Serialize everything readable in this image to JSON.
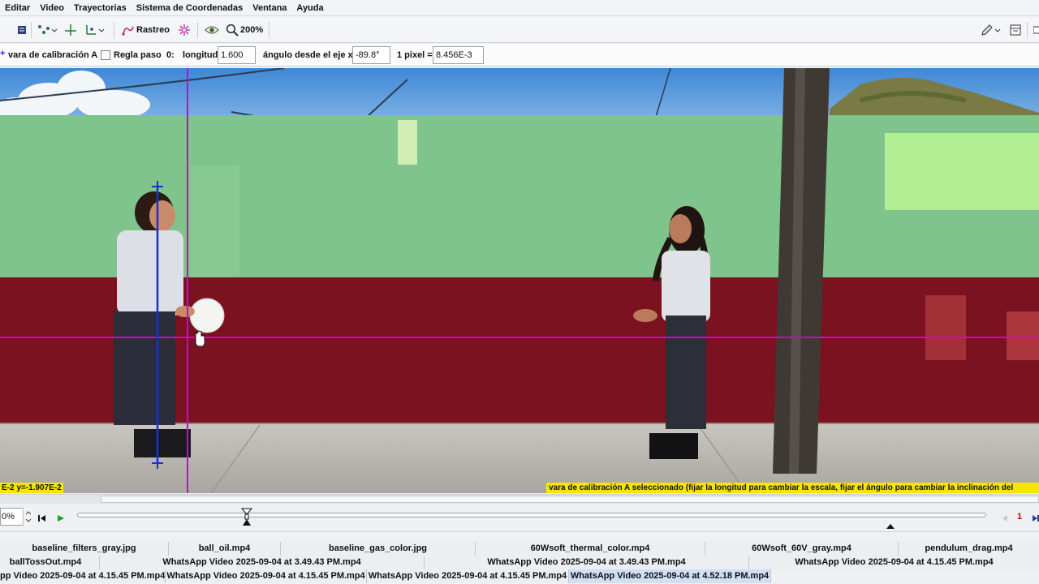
{
  "menu": [
    "Editar",
    "Video",
    "Trayectorias",
    "Sistema de Coordenadas",
    "Ventana",
    "Ayuda"
  ],
  "toolbar": {
    "tracking_label": "Rastreo",
    "zoom_label": "200%"
  },
  "calibration": {
    "name": "vara de calibración A",
    "step_rule_label": "Regla paso",
    "step_value": "0:",
    "length_label": "longitud",
    "length_value": "1.600 m",
    "angle_label": "ángulo desde el eje x",
    "angle_value": "-89.8°",
    "pixel_label": "1 pixel =",
    "pixel_value": "8.456E-3 m"
  },
  "video": {
    "coordinate_readout": "E-2  y=-1.907E-2",
    "status_message": "vara de calibración A seleccionado (fijar la longitud para cambiar la escala, fijar el ángulo para cambiar la inclinación del"
  },
  "player": {
    "rate_value": "0%",
    "end_frame": "1"
  },
  "file_tabs": {
    "row1": [
      "baseline_filters_gray.jpg",
      "ball_oil.mp4",
      "baseline_gas_color.jpg",
      "60Wsoft_thermal_color.mp4",
      "60Wsoft_60V_gray.mp4",
      "pendulum_drag.mp4"
    ],
    "row2": [
      "ballTossOut.mp4",
      "WhatsApp Video 2025-09-04 at 3.49.43 PM.mp4",
      "WhatsApp Video 2025-09-04 at 3.49.43 PM.mp4",
      "WhatsApp Video 2025-09-04 at 4.15.45 PM.mp4"
    ],
    "row3": [
      "pp Video 2025-09-04 at 4.15.45 PM.mp4",
      "WhatsApp Video 2025-09-04 at 4.15.45 PM.mp4",
      "WhatsApp Video 2025-09-04 at 4.15.45 PM.mp4",
      "WhatsApp Video 2025-09-04 at 4.52.18 PM.mp4"
    ],
    "active_tab": "WhatsApp Video 2025-09-04 at 4.52.18 PM.mp4"
  },
  "colors": {
    "axis_magenta": "#d400d4",
    "calibration_blue": "#1a2fd6",
    "status_yellow": "#f5e600",
    "active_tab_blue": "#cfe0f4"
  }
}
